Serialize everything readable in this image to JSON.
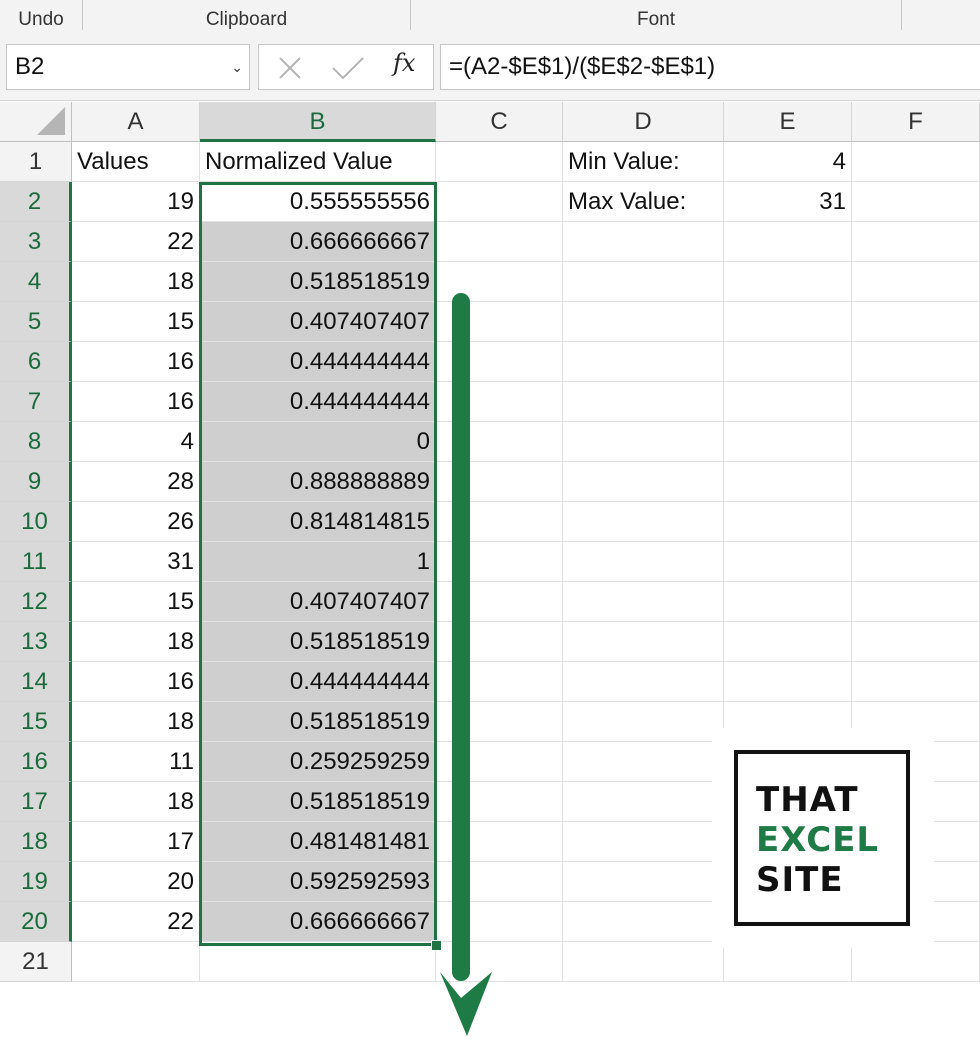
{
  "ribbon": {
    "groups": [
      "Undo",
      "Clipboard",
      "Font"
    ]
  },
  "formula_bar": {
    "name_box": "B2",
    "cancel_icon": "x-icon",
    "enter_icon": "check-icon",
    "fx_label": "fx",
    "formula": "=(A2-$E$1)/($E$2-$E$1)"
  },
  "columns": [
    "A",
    "B",
    "C",
    "D",
    "E",
    "F"
  ],
  "selected_column": "B",
  "rows": [
    {
      "num": "1",
      "A": "Values",
      "B": "Normalized Value",
      "D": "Min Value:",
      "E": "4"
    },
    {
      "num": "2",
      "A": "19",
      "B": "0.555555556",
      "D": "Max Value:",
      "E": "31"
    },
    {
      "num": "3",
      "A": "22",
      "B": "0.666666667"
    },
    {
      "num": "4",
      "A": "18",
      "B": "0.518518519"
    },
    {
      "num": "5",
      "A": "15",
      "B": "0.407407407"
    },
    {
      "num": "6",
      "A": "16",
      "B": "0.444444444"
    },
    {
      "num": "7",
      "A": "16",
      "B": "0.444444444"
    },
    {
      "num": "8",
      "A": "4",
      "B": "0"
    },
    {
      "num": "9",
      "A": "28",
      "B": "0.888888889"
    },
    {
      "num": "10",
      "A": "26",
      "B": "0.814814815"
    },
    {
      "num": "11",
      "A": "31",
      "B": "1"
    },
    {
      "num": "12",
      "A": "15",
      "B": "0.407407407"
    },
    {
      "num": "13",
      "A": "18",
      "B": "0.518518519"
    },
    {
      "num": "14",
      "A": "16",
      "B": "0.444444444"
    },
    {
      "num": "15",
      "A": "18",
      "B": "0.518518519"
    },
    {
      "num": "16",
      "A": "11",
      "B": "0.259259259"
    },
    {
      "num": "17",
      "A": "18",
      "B": "0.518518519"
    },
    {
      "num": "18",
      "A": "17",
      "B": "0.481481481"
    },
    {
      "num": "19",
      "A": "20",
      "B": "0.592592593"
    },
    {
      "num": "20",
      "A": "22",
      "B": "0.666666667"
    },
    {
      "num": "21"
    }
  ],
  "selection": {
    "active_cell": "B2",
    "range": "B2:B20"
  },
  "annotation": {
    "icon": "down-arrow-icon",
    "color": "#1e7b45"
  },
  "logo": {
    "lines": [
      "THAT",
      "EXCEL",
      "SITE"
    ],
    "colors": [
      "#111111",
      "#1e7b45",
      "#111111"
    ]
  },
  "colors": {
    "excel_green": "#217346",
    "selection_shade": "#cfcfcf"
  }
}
